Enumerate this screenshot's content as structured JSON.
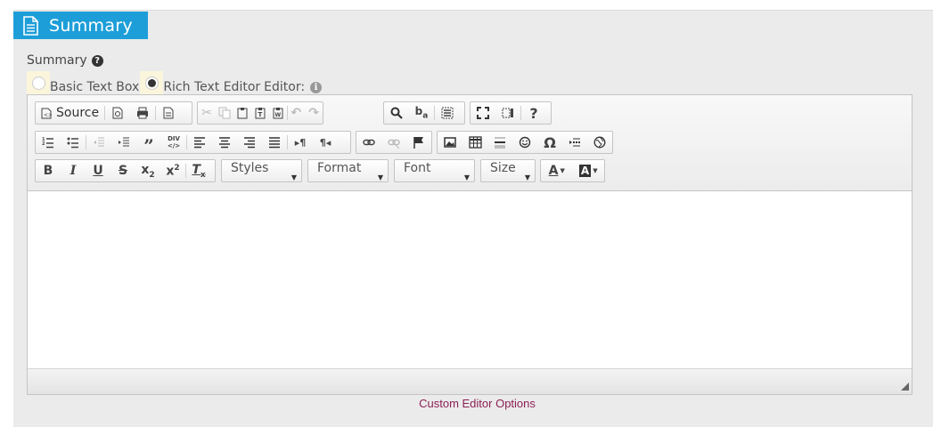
{
  "header": {
    "title": "Summary",
    "icon": "document-icon"
  },
  "field": {
    "label": "Summary"
  },
  "radios": {
    "basic_label": "Basic Text Box",
    "rich_label": "Rich Text Editor",
    "editor_label": "Editor:",
    "selected": "rich"
  },
  "toolbar": {
    "source_label": "Source",
    "styles_label": "Styles",
    "format_label": "Format",
    "font_label": "Font",
    "size_label": "Size"
  },
  "link": {
    "custom_editor_options": "Custom Editor Options"
  },
  "colors": {
    "header_bg": "#1d9ed9",
    "link": "#8b2056"
  }
}
